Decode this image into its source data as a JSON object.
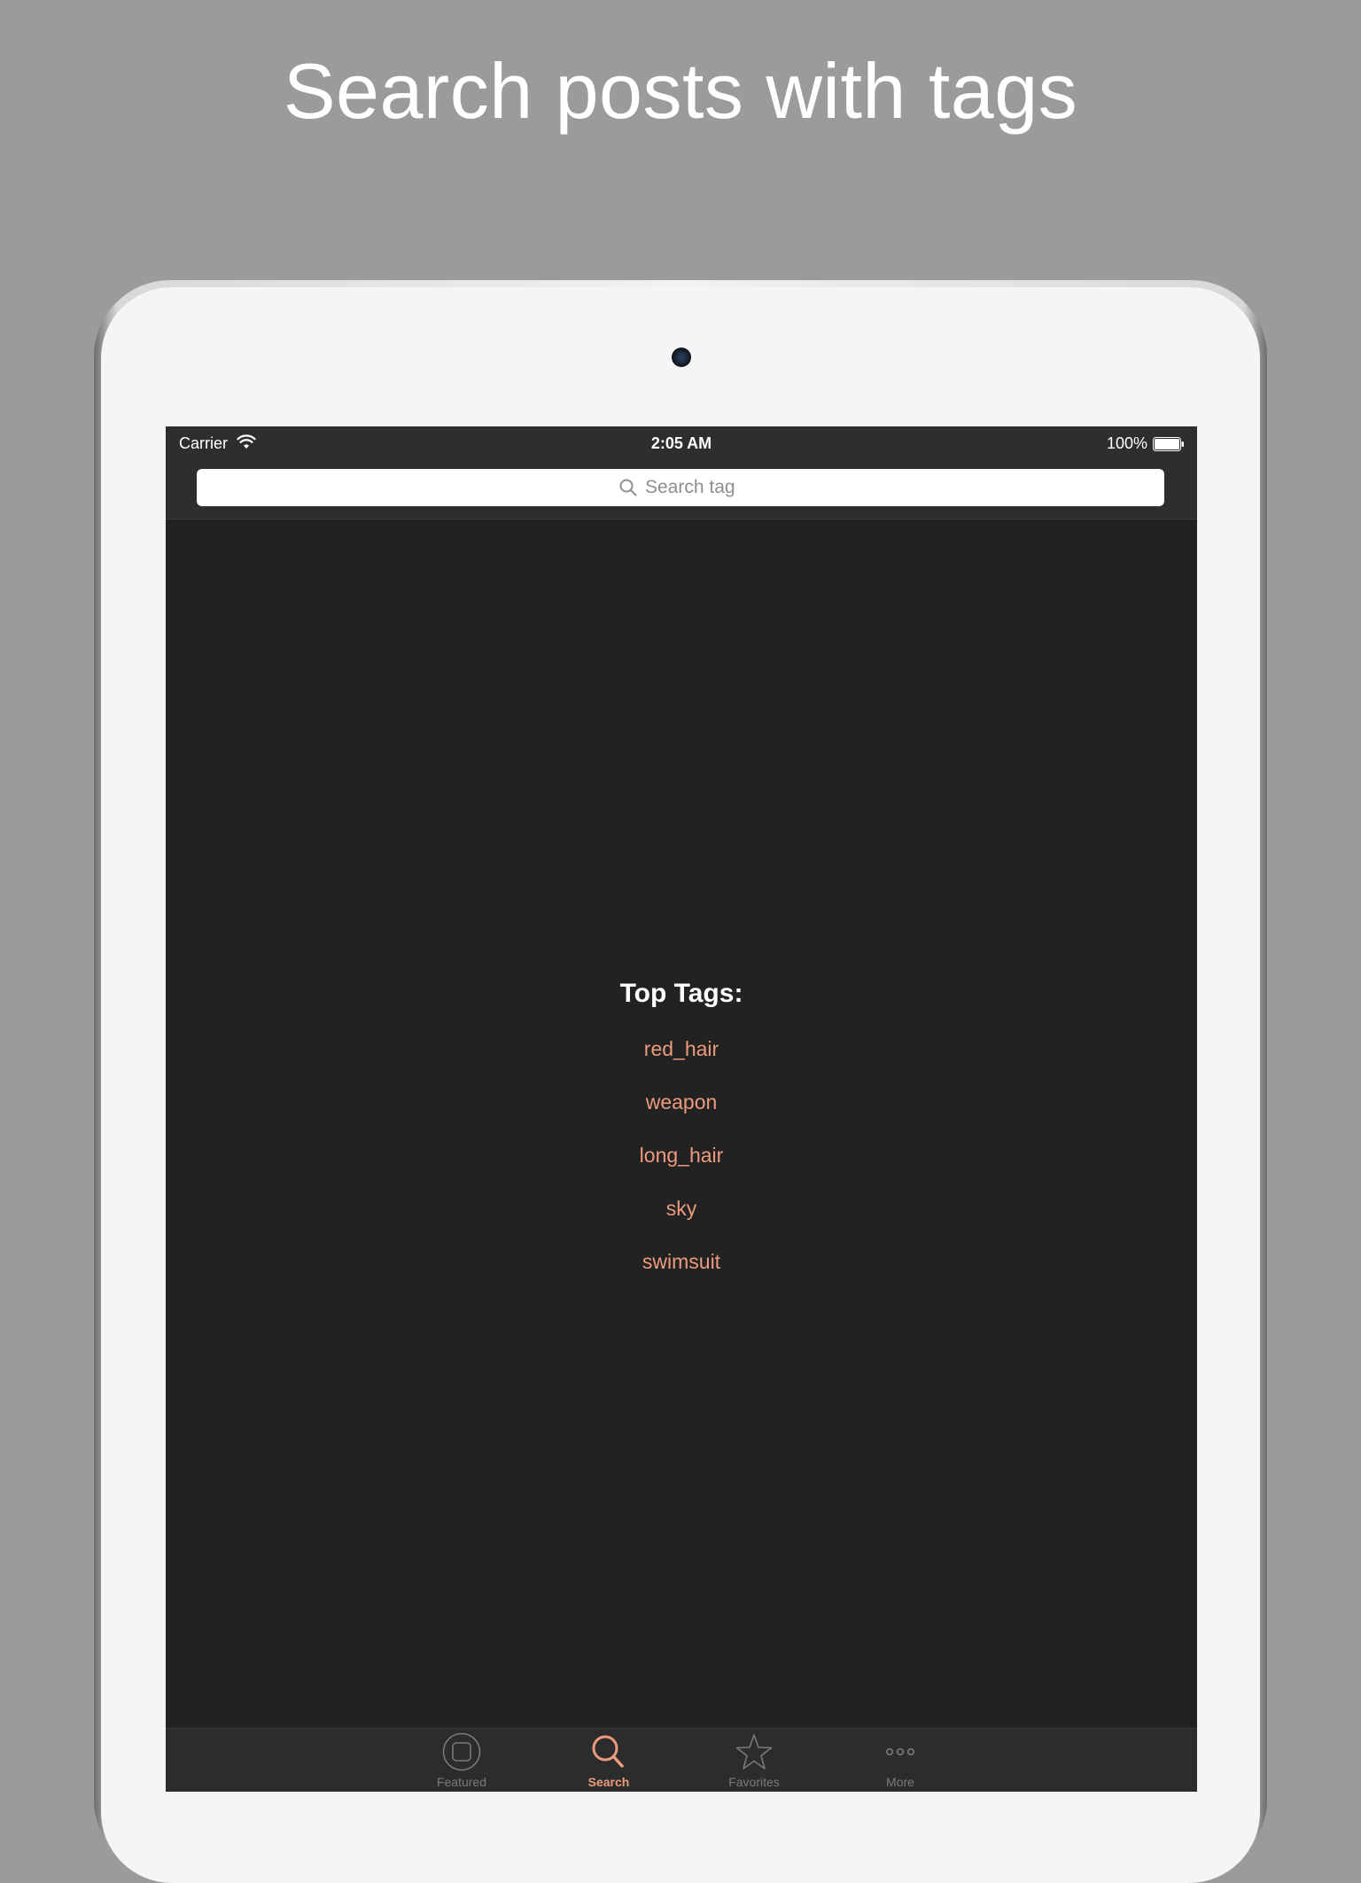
{
  "headline": "Search posts with tags",
  "status_bar": {
    "carrier": "Carrier",
    "time": "2:05 AM",
    "battery": "100%"
  },
  "search": {
    "placeholder": "Search tag",
    "value": ""
  },
  "top_tags": {
    "title": "Top Tags:",
    "items": [
      "red_hair",
      "weapon",
      "long_hair",
      "sky",
      "swimsuit"
    ]
  },
  "tab_bar": {
    "items": [
      {
        "label": "Featured",
        "icon": "featured-icon",
        "active": false
      },
      {
        "label": "Search",
        "icon": "search-icon",
        "active": true
      },
      {
        "label": "Favorites",
        "icon": "star-icon",
        "active": false
      },
      {
        "label": "More",
        "icon": "more-icon",
        "active": false
      }
    ]
  },
  "colors": {
    "background": "#9b9b9b",
    "screen": "#222222",
    "bar": "#2e2e2e",
    "accent": "#ec9b7e",
    "inactive_tab": "#7a7a7a"
  }
}
